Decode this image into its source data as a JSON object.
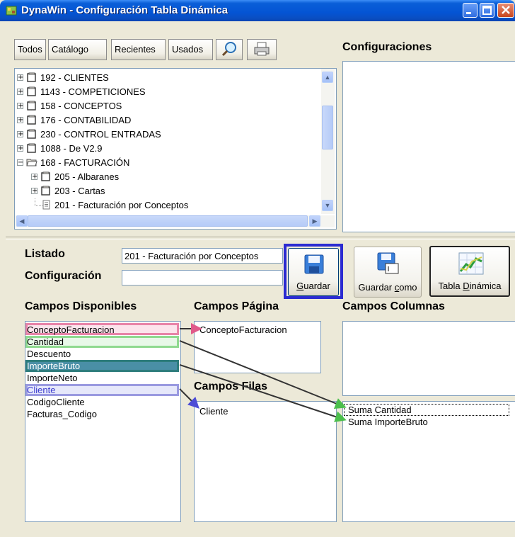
{
  "window": {
    "title": "DynaWin - Configuración Tabla Dinámica"
  },
  "toolbar": {
    "todos": "Todos",
    "catalogo": "Catálogo",
    "recientes": "Recientes",
    "usados": "Usados"
  },
  "sections": {
    "configuraciones": "Configuraciones",
    "listado": "Listado",
    "configuracion": "Configuración",
    "campos_disponibles": "Campos Disponibles",
    "campos_pagina": "Campos Página",
    "campos_columnas": "Campos Columnas",
    "campos_filas": "Campos Filas"
  },
  "tree": {
    "items": [
      {
        "label": "192 - CLIENTES",
        "level": 0,
        "expanded": false
      },
      {
        "label": "1143 - COMPETICIONES",
        "level": 0,
        "expanded": false
      },
      {
        "label": "158 - CONCEPTOS",
        "level": 0,
        "expanded": false
      },
      {
        "label": "176 - CONTABILIDAD",
        "level": 0,
        "expanded": false
      },
      {
        "label": "230 - CONTROL ENTRADAS",
        "level": 0,
        "expanded": false
      },
      {
        "label": "1088 - De V2.9",
        "level": 0,
        "expanded": false
      },
      {
        "label": "168 - FACTURACIÓN",
        "level": 0,
        "expanded": true
      },
      {
        "label": "205 - Albaranes",
        "level": 1,
        "expanded": false
      },
      {
        "label": "203 - Cartas",
        "level": 1,
        "expanded": false
      },
      {
        "label": "201 - Facturación por Conceptos",
        "level": 1,
        "leaf": true
      }
    ]
  },
  "form": {
    "listado_value": "201 - Facturación por Conceptos",
    "configuracion_value": ""
  },
  "buttons": {
    "guardar_key": "G",
    "guardar_rest": "uardar",
    "guardar_como_pre": "Guardar ",
    "guardar_como_key": "c",
    "guardar_como_rest": "omo",
    "tabla_pre": "Tabla ",
    "tabla_key": "D",
    "tabla_rest": "inámica"
  },
  "campos_disponibles": [
    "ConceptoFacturacion",
    "Cantidad",
    "Descuento",
    "ImporteBruto",
    "ImporteNeto",
    "Cliente",
    "CodigoCliente",
    "Facturas_Codigo"
  ],
  "campos_pagina": [
    "ConceptoFacturacion"
  ],
  "campos_filas": [
    "Cliente"
  ],
  "campos_datos": [
    "Suma Cantidad",
    "Suma ImporteBruto"
  ],
  "colors": {
    "pink": "#e884a8",
    "green": "#8fd98f",
    "teal": "#2e7d7d",
    "lavender": "#9a9ae0",
    "focus": "#2b2bd1"
  }
}
